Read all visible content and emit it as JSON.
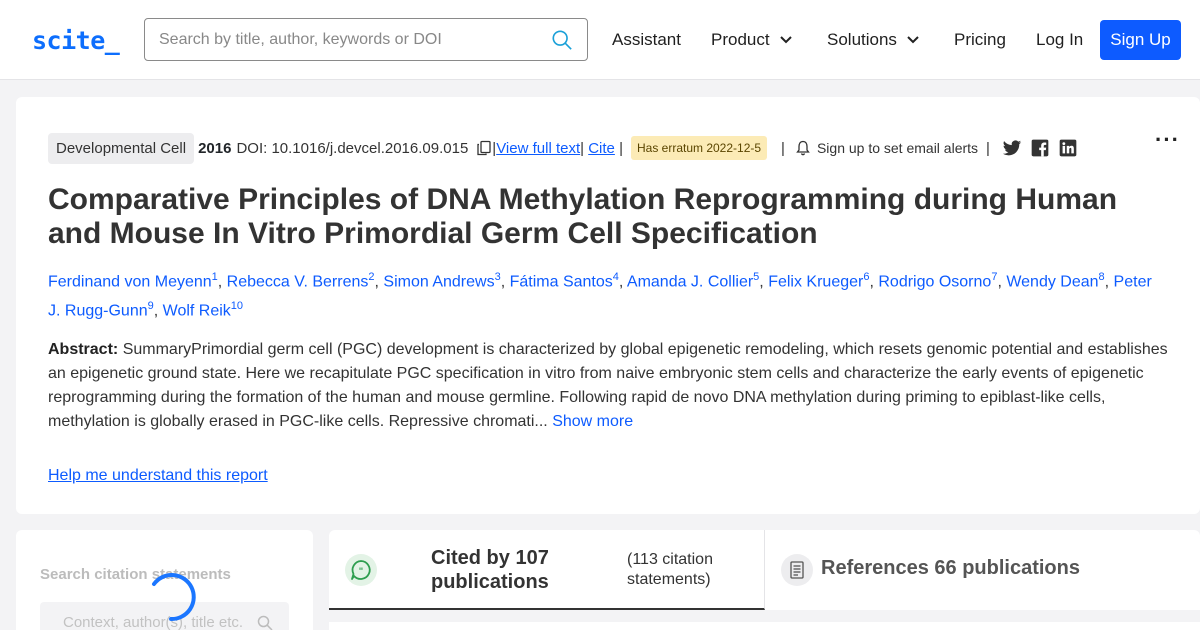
{
  "header": {
    "logo": "scite_",
    "search_placeholder": "Search by title, author, keywords or DOI",
    "nav": {
      "assistant": "Assistant",
      "product": "Product",
      "solutions": "Solutions",
      "pricing": "Pricing",
      "login": "Log In",
      "signup": "Sign Up"
    }
  },
  "paper": {
    "journal": "Developmental Cell",
    "year": "2016",
    "doi": "DOI: 10.1016/j.devcel.2016.09.015",
    "view_full_text": "View full text",
    "cite": "Cite",
    "erratum": "Has erratum 2022-12-5",
    "alerts": "Sign up to set email alerts",
    "more": "···",
    "title": "Comparative Principles of DNA Methylation Reprogramming during Human and Mouse In Vitro Primordial Germ Cell Specification",
    "authors": [
      {
        "name": "Ferdinand von Meyenn",
        "sup": "1"
      },
      {
        "name": "Rebecca V. Berrens",
        "sup": "2"
      },
      {
        "name": "Simon Andrews",
        "sup": "3"
      },
      {
        "name": "Fátima Santos",
        "sup": "4"
      },
      {
        "name": "Amanda J. Collier",
        "sup": "5"
      },
      {
        "name": "Felix Krueger",
        "sup": "6"
      },
      {
        "name": "Rodrigo Osorno",
        "sup": "7"
      },
      {
        "name": "Wendy Dean",
        "sup": "8"
      },
      {
        "name": "Peter J. Rugg-Gunn",
        "sup": "9"
      },
      {
        "name": "Wolf Reik",
        "sup": "10"
      }
    ],
    "abstract_label": "Abstract:",
    "abstract_text": "SummaryPrimordial germ cell (PGC) development is characterized by global epigenetic remodeling, which resets genomic potential and establishes an epigenetic ground state. Here we recapitulate PGC specification in vitro from naive embryonic stem cells and characterize the early events of epigenetic reprogramming during the formation of the human and mouse germline. Following rapid de novo DNA methylation during priming to epiblast-like cells, methylation is globally erased in PGC-like cells. Repressive chromati...",
    "show_more": "Show more",
    "help": "Help me understand this report"
  },
  "citations": {
    "search_label": "Search citation statements",
    "context_placeholder": "Context, author(s), title etc.",
    "cited_by": "Cited by 107 publications",
    "statements": "(113 citation statements)",
    "references": "References 66 publications"
  },
  "colors": {
    "accent": "#0d5bff",
    "erratum_bg": "#fcebb6",
    "cited_icon": "#2e9e4f"
  }
}
